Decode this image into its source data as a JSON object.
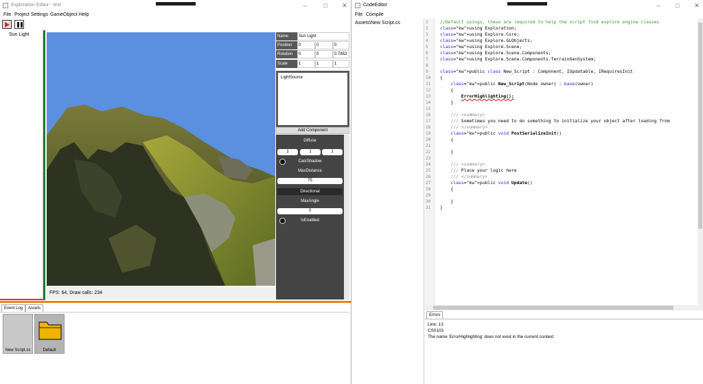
{
  "editor": {
    "title": "Exploration Editor - test",
    "menu": [
      "File",
      "Project Settings",
      "GameObject",
      "Help"
    ],
    "hierarchy": [
      "Sun Light"
    ],
    "status": "FPS: 64, Draw calls: 234",
    "inspector": {
      "name_label": "Name",
      "name_value": "Sun Light",
      "position_label": "Position",
      "position": [
        "0",
        "0",
        "0"
      ],
      "rotation_label": "Rotation",
      "rotation": [
        "0",
        "0",
        "0.7853"
      ],
      "scale_label": "Scale",
      "scale": [
        "1",
        "1",
        "1"
      ],
      "components": [
        "LightSource"
      ],
      "add_component": "Add Component"
    },
    "light": {
      "diffuse_label": "Diffuse",
      "diffuse": [
        "1",
        "1",
        "1"
      ],
      "cast_shadow": "CastShadow",
      "max_distance_label": "MaxDistance",
      "max_distance": "75",
      "directional": "Directional",
      "max_angle_label": "MaxAngle",
      "max_angle": "0",
      "is_enabled": "IsEnabled"
    },
    "bottom_tabs": [
      "Event Log",
      "Assets"
    ],
    "assets": [
      "New Script.cs",
      "Default"
    ]
  },
  "code_editor": {
    "title": "CodeEditor",
    "menu": [
      "File",
      "Compile"
    ],
    "file": "Assets\\New Script.cs",
    "lines": [
      "//Default usings, these are required to help the script find explore engine classes",
      "using Exploration;",
      "using Explore.Core;",
      "using Explore.GLObjects;",
      "using Explore.Scene;",
      "using Explore.Scene.Components;",
      "using Explore.Scene.Components.TerrainGenSystem;",
      "",
      "public class New_Script : Component, IUpdatable, IRequiresInit",
      "{",
      "    public New_Script(Node owner) : base(owner)",
      "    {",
      "        ErrorHighlighting();",
      "    }",
      "",
      "    /// <summary>",
      "    /// Sometimes you need to do something to initialize your object after loading from",
      "    /// </summary>",
      "    public void PostSerializeInit()",
      "    {",
      "",
      "    }",
      "",
      "    /// <summary>",
      "    /// Place your logic here",
      "    /// </summary>",
      "    public void Update()",
      "    {",
      "",
      "    }",
      "}"
    ],
    "errors_tab": "Errors",
    "errors": [
      "Line: 13",
      "CS0103",
      "The name 'ErrorHighlighting' does not exist in the current context"
    ]
  }
}
